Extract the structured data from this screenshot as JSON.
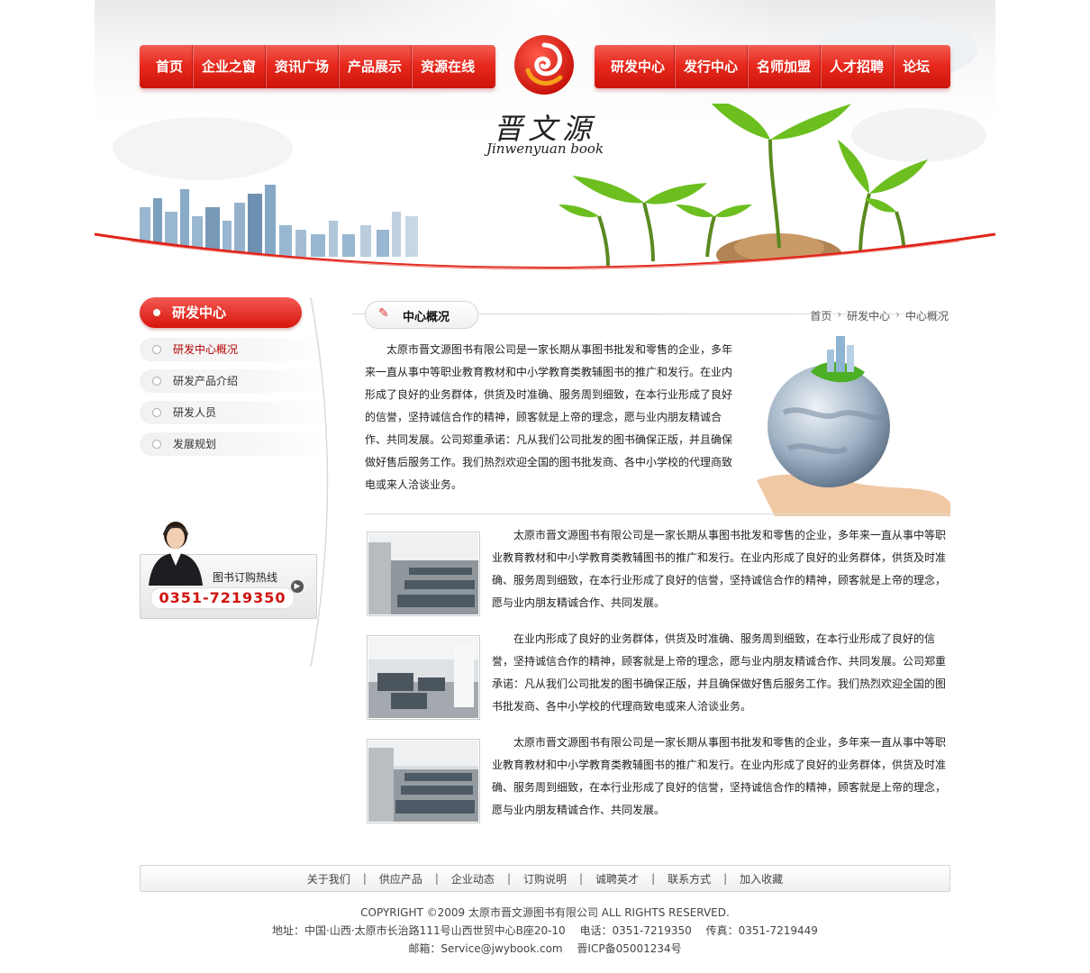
{
  "nav_left": [
    "首页",
    "企业之窗",
    "资讯广场",
    "产品展示",
    "资源在线"
  ],
  "nav_right": [
    "研发中心",
    "发行中心",
    "名师加盟",
    "人才招聘",
    "论坛"
  ],
  "brand": {
    "cn": "晋文源",
    "en": "Jinwenyuan book"
  },
  "sidebar": {
    "title": "研发中心",
    "items": [
      {
        "label": "研发中心概况",
        "active": true
      },
      {
        "label": "研发产品介绍",
        "active": false
      },
      {
        "label": "研发人员",
        "active": false
      },
      {
        "label": "发展规划",
        "active": false
      }
    ],
    "hotline_label": "图书订购热线",
    "hotline_phone": "0351-7219350"
  },
  "main": {
    "section_title": "中心概况",
    "breadcrumb": [
      "首页",
      "研发中心",
      "中心概况"
    ],
    "intro": "太原市晋文源图书有限公司是一家长期从事图书批发和零售的企业，多年来一直从事中等职业教育教材和中小学教育类教辅图书的推广和发行。在业内形成了良好的业务群体，供货及时准确、服务周到细致，在本行业形成了良好的信誉，坚持诚信合作的精神，顾客就是上帝的理念，愿与业内朋友精诚合作、共同发展。公司郑重承诺：凡从我们公司批发的图书确保正版，并且确保做好售后服务工作。我们热烈欢迎全国的图书批发商、各中小学校的代理商致电或来人洽谈业务。",
    "rows": [
      {
        "text": "太原市晋文源图书有限公司是一家长期从事图书批发和零售的企业，多年来一直从事中等职业教育教材和中小学教育类教辅图书的推广和发行。在业内形成了良好的业务群体，供货及时准确、服务周到细致，在本行业形成了良好的信誉，坚持诚信合作的精神，顾客就是上帝的理念，愿与业内朋友精诚合作、共同发展。"
      },
      {
        "text": "在业内形成了良好的业务群体，供货及时准确、服务周到细致，在本行业形成了良好的信誉，坚持诚信合作的精神，顾客就是上帝的理念，愿与业内朋友精诚合作、共同发展。公司郑重承诺：凡从我们公司批发的图书确保正版，并且确保做好售后服务工作。我们热烈欢迎全国的图书批发商、各中小学校的代理商致电或来人洽谈业务。"
      },
      {
        "text": "太原市晋文源图书有限公司是一家长期从事图书批发和零售的企业，多年来一直从事中等职业教育教材和中小学教育类教辅图书的推广和发行。在业内形成了良好的业务群体，供货及时准确、服务周到细致，在本行业形成了良好的信誉，坚持诚信合作的精神，顾客就是上帝的理念，愿与业内朋友精诚合作、共同发展。"
      }
    ]
  },
  "footer": {
    "links": [
      "关于我们",
      "供应产品",
      "企业动态",
      "订购说明",
      "诚聘英才",
      "联系方式",
      "加入收藏"
    ],
    "copyright": "COPYRIGHT ©2009 太原市晋文源图书有限公司 ALL RIGHTS RESERVED.",
    "address": "地址：中国·山西·太原市长治路111号山西世贸中心B座20-10　 电话：0351-7219350　 传真：0351-7219449",
    "email": "邮箱：Service@jwybook.com　 晋ICP备05001234号"
  },
  "colors": {
    "accent": "#e0241a",
    "nav_dark": "#cc140a",
    "phone": "#d01410"
  }
}
